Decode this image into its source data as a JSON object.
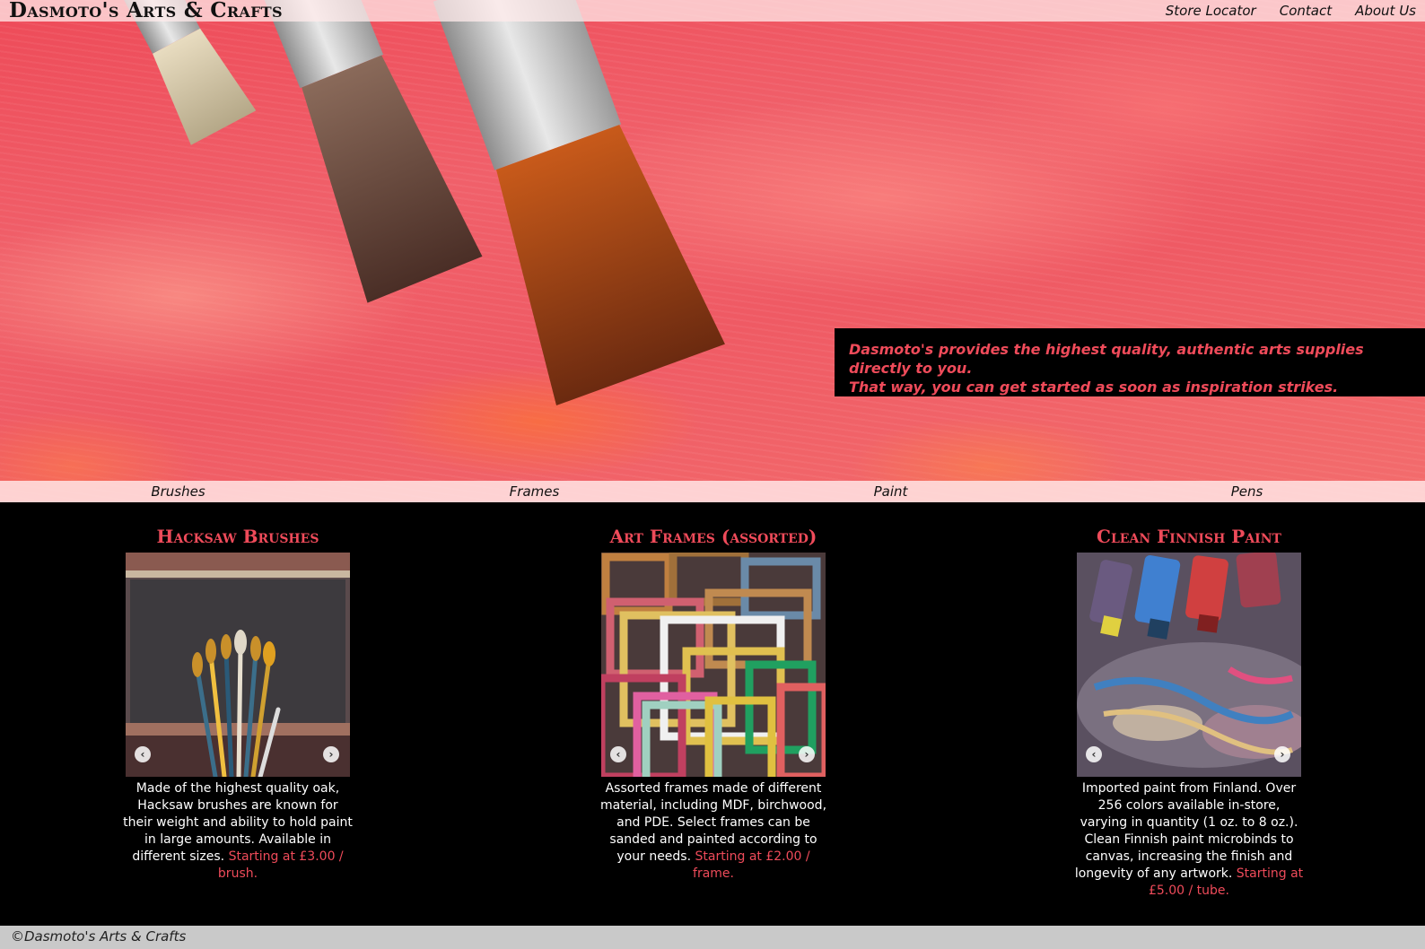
{
  "header": {
    "logo": "Dasmoto's Arts & Crafts",
    "nav": [
      "Store Locator",
      "Contact",
      "About Us"
    ]
  },
  "hero": {
    "mission_line1": "Dasmoto's provides the highest quality, authentic arts supplies directly to you.",
    "mission_line2": "That way, you can get started as soon as inspiration strikes."
  },
  "categories": [
    "Brushes",
    "Frames",
    "Paint",
    "Pens"
  ],
  "products": [
    {
      "title": "Hacksaw Brushes",
      "description": "Made of the highest quality oak, Hacksaw brushes are known for their weight and ability to hold paint in large amounts. Available in different sizes. ",
      "price": "Starting at £3.00 / brush."
    },
    {
      "title": "Art Frames (assorted)",
      "description": "Assorted frames made of different material, including MDF, birchwood, and PDE. Select frames can be sanded and painted according to your needs. ",
      "price": "Starting at £2.00 / frame."
    },
    {
      "title": "Clean Finnish Paint",
      "description": "Imported paint from Finland. Over 256 colors available in-store, varying in quantity (1 oz. to 8 oz.). Clean Finnish paint microbinds to canvas, increasing the finish and longevity of any artwork. ",
      "price": "Starting at £5.00 / tube."
    }
  ],
  "footer": {
    "text": "©Dasmoto's Arts & Crafts"
  },
  "colors": {
    "accent": "#ef4b5a",
    "background": "#000000",
    "footer": "#c9c9c9"
  },
  "icons": {
    "prev": "chevron-left-icon",
    "next": "chevron-right-icon"
  }
}
